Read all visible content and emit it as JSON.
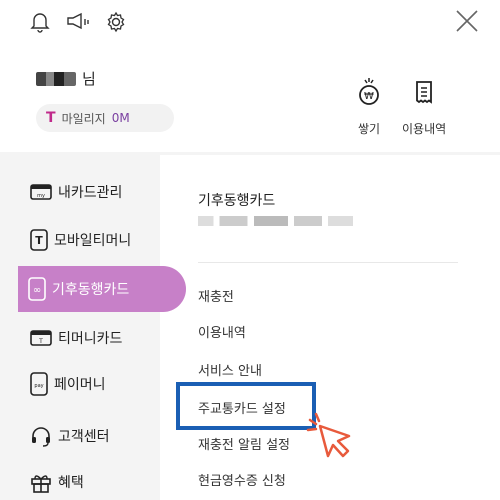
{
  "user": {
    "suffix": "님"
  },
  "mileage": {
    "badge": "T",
    "label": "마일리지",
    "value": "0M"
  },
  "quick_actions": [
    {
      "label": "쌓기",
      "icon": "coin-icon"
    },
    {
      "label": "이용내역",
      "icon": "receipt-icon"
    }
  ],
  "sidebar": {
    "items": [
      {
        "label": "내카드관리",
        "icon": "card-my-icon"
      },
      {
        "label": "모바일티머니",
        "icon": "mobile-t-icon"
      },
      {
        "label": "기후동행카드",
        "icon": "phone-infinity-icon"
      },
      {
        "label": "티머니카드",
        "icon": "card-t-icon"
      },
      {
        "label": "페이머니",
        "icon": "phone-pay-icon"
      },
      {
        "label": "고객센터",
        "icon": "headset-icon"
      },
      {
        "label": "혜택",
        "icon": "gift-icon"
      }
    ],
    "active_index": 2
  },
  "card": {
    "title": "기후동행카드"
  },
  "menu": {
    "items": [
      "재충전",
      "이용내역",
      "서비스 안내",
      "주교통카드 설정",
      "재충전 알림 설정",
      "현금영수증 신청"
    ],
    "highlighted_index": 3
  },
  "colors": {
    "accent": "#c780c8",
    "highlight": "#1a5fb4",
    "cursor": "#e85a3c"
  }
}
